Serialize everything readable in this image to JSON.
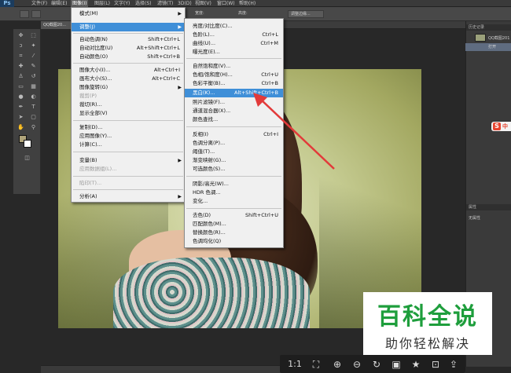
{
  "app": {
    "logo": "Ps"
  },
  "menubar": [
    "文件(F)",
    "编辑(E)",
    "图像(I)",
    "图层(L)",
    "文字(Y)",
    "选择(S)",
    "滤镜(T)",
    "3D(D)",
    "视图(V)",
    "窗口(W)",
    "帮助(H)"
  ],
  "options": {
    "left_field": "宽度:",
    "mid_field": "高度:",
    "right_field": "调整边缘..."
  },
  "document_tab": "QQ截图20...",
  "image_menu": {
    "items": [
      {
        "label": "模式(M)",
        "shortcut": "",
        "submenu": true,
        "disabled": false
      },
      {
        "label": "调整(J)",
        "shortcut": "",
        "submenu": true,
        "disabled": false,
        "highlighted": true
      },
      {
        "label": "自动色调(N)",
        "shortcut": "Shift+Ctrl+L",
        "disabled": false
      },
      {
        "label": "自动对比度(U)",
        "shortcut": "Alt+Shift+Ctrl+L",
        "disabled": false
      },
      {
        "label": "自动颜色(O)",
        "shortcut": "Shift+Ctrl+B",
        "disabled": false
      },
      {
        "label": "图像大小(I)...",
        "shortcut": "Alt+Ctrl+I",
        "disabled": false
      },
      {
        "label": "画布大小(S)...",
        "shortcut": "Alt+Ctrl+C",
        "disabled": false
      },
      {
        "label": "图像旋转(G)",
        "shortcut": "",
        "submenu": true,
        "disabled": false
      },
      {
        "label": "裁剪(P)",
        "shortcut": "",
        "disabled": true
      },
      {
        "label": "裁切(R)...",
        "shortcut": "",
        "disabled": false
      },
      {
        "label": "显示全部(V)",
        "shortcut": "",
        "disabled": false
      },
      {
        "label": "复制(D)...",
        "shortcut": "",
        "disabled": false
      },
      {
        "label": "应用图像(Y)...",
        "shortcut": "",
        "disabled": false
      },
      {
        "label": "计算(C)...",
        "shortcut": "",
        "disabled": false
      },
      {
        "label": "变量(B)",
        "shortcut": "",
        "submenu": true,
        "disabled": false
      },
      {
        "label": "应用数据组(L)...",
        "shortcut": "",
        "disabled": true
      },
      {
        "label": "陷印(T)...",
        "shortcut": "",
        "disabled": true
      },
      {
        "label": "分析(A)",
        "shortcut": "",
        "submenu": true,
        "disabled": false
      }
    ]
  },
  "adjust_menu": {
    "items": [
      {
        "label": "亮度/对比度(C)...",
        "shortcut": ""
      },
      {
        "label": "色阶(L)...",
        "shortcut": "Ctrl+L"
      },
      {
        "label": "曲线(U)...",
        "shortcut": "Ctrl+M"
      },
      {
        "label": "曝光度(E)...",
        "shortcut": ""
      },
      {
        "label": "自然饱和度(V)...",
        "shortcut": ""
      },
      {
        "label": "色相/饱和度(H)...",
        "shortcut": "Ctrl+U"
      },
      {
        "label": "色彩平衡(B)...",
        "shortcut": "Ctrl+B"
      },
      {
        "label": "黑白(K)...",
        "shortcut": "Alt+Shift+Ctrl+B",
        "highlighted": true
      },
      {
        "label": "照片滤镜(F)...",
        "shortcut": ""
      },
      {
        "label": "通道混合器(X)...",
        "shortcut": ""
      },
      {
        "label": "颜色查找...",
        "shortcut": ""
      },
      {
        "label": "反相(I)",
        "shortcut": "Ctrl+I"
      },
      {
        "label": "色调分离(P)...",
        "shortcut": ""
      },
      {
        "label": "阈值(T)...",
        "shortcut": ""
      },
      {
        "label": "渐变映射(G)...",
        "shortcut": ""
      },
      {
        "label": "可选颜色(S)...",
        "shortcut": ""
      },
      {
        "label": "阴影/高光(W)...",
        "shortcut": ""
      },
      {
        "label": "HDR 色调...",
        "shortcut": ""
      },
      {
        "label": "变化...",
        "shortcut": ""
      },
      {
        "label": "去色(D)",
        "shortcut": "Shift+Ctrl+U"
      },
      {
        "label": "匹配颜色(M)...",
        "shortcut": ""
      },
      {
        "label": "替换颜色(R)...",
        "shortcut": ""
      },
      {
        "label": "色调均化(Q)",
        "shortcut": ""
      }
    ]
  },
  "history_panel": {
    "title": "历史记录",
    "snapshot": "QQ截图201",
    "open_item": "打开"
  },
  "properties_panel": {
    "title": "属性",
    "content": "无属性"
  },
  "watermark": {
    "title": "百科全说",
    "subtitle": "助你轻松解决"
  },
  "sogou": {
    "s": "S",
    "zh": "中"
  },
  "viewer_toolbar": {
    "ratio": "1:1"
  },
  "colors": {
    "highlight": "#3f8fd8",
    "arrow": "#e23a3a",
    "watermark_green": "#1e9e3c"
  }
}
